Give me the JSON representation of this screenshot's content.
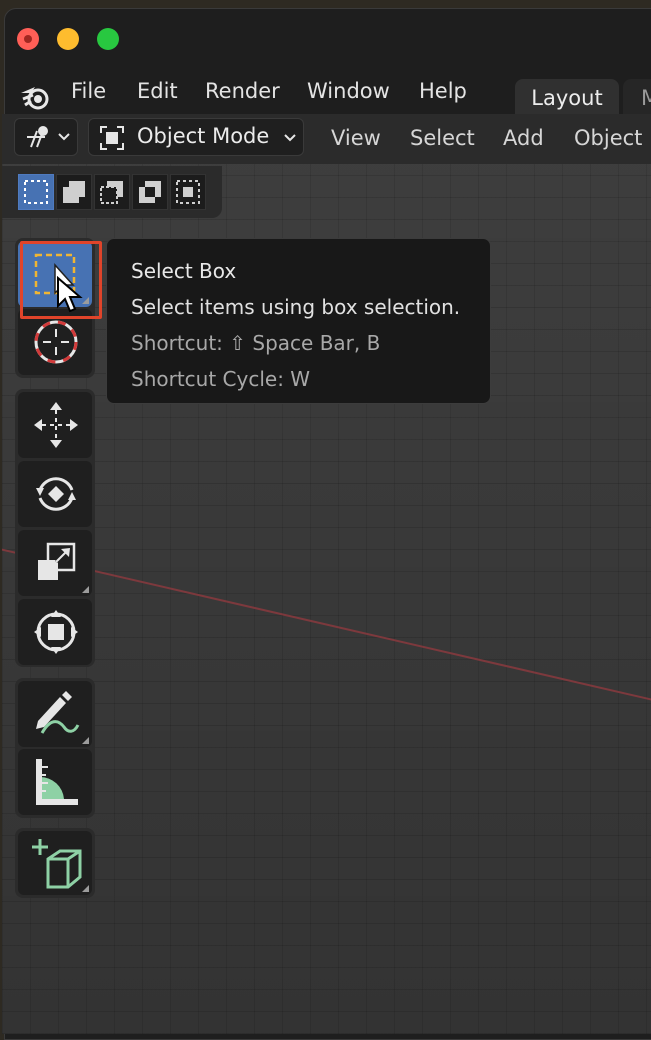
{
  "titlebar": {
    "lights": [
      "close",
      "minimize",
      "maximize"
    ]
  },
  "menubar": {
    "items": [
      "File",
      "Edit",
      "Render",
      "Window",
      "Help"
    ]
  },
  "workspace_tabs": {
    "active": "Layout",
    "next_partial": "M"
  },
  "header": {
    "mode": "Object Mode",
    "menus": [
      "View",
      "Select",
      "Add",
      "Object"
    ]
  },
  "selection_modes": {
    "items": [
      "set-new-icon",
      "extend-icon",
      "subtract-icon",
      "invert-icon",
      "intersect-icon"
    ],
    "active_index": 0
  },
  "toolbar": {
    "groups": [
      {
        "tools": [
          "select-box-icon",
          "cursor-icon"
        ]
      },
      {
        "tools": [
          "move-icon",
          "rotate-icon",
          "scale-icon",
          "transform-icon"
        ]
      },
      {
        "tools": [
          "annotate-icon",
          "measure-icon"
        ]
      },
      {
        "tools": [
          "add-cube-icon"
        ]
      }
    ],
    "active_tool": "select-box-icon"
  },
  "tooltip": {
    "title": "Select Box",
    "description": "Select items using box selection.",
    "shortcut": "Shortcut: ⇧ Space Bar, B",
    "shortcut_cycle": "Shortcut Cycle: W"
  },
  "colors": {
    "accent": "#4772b3",
    "highlight": "#e0442a",
    "x_axis": "#8a3a3e",
    "gizmo_green": "#8ed1a5"
  }
}
